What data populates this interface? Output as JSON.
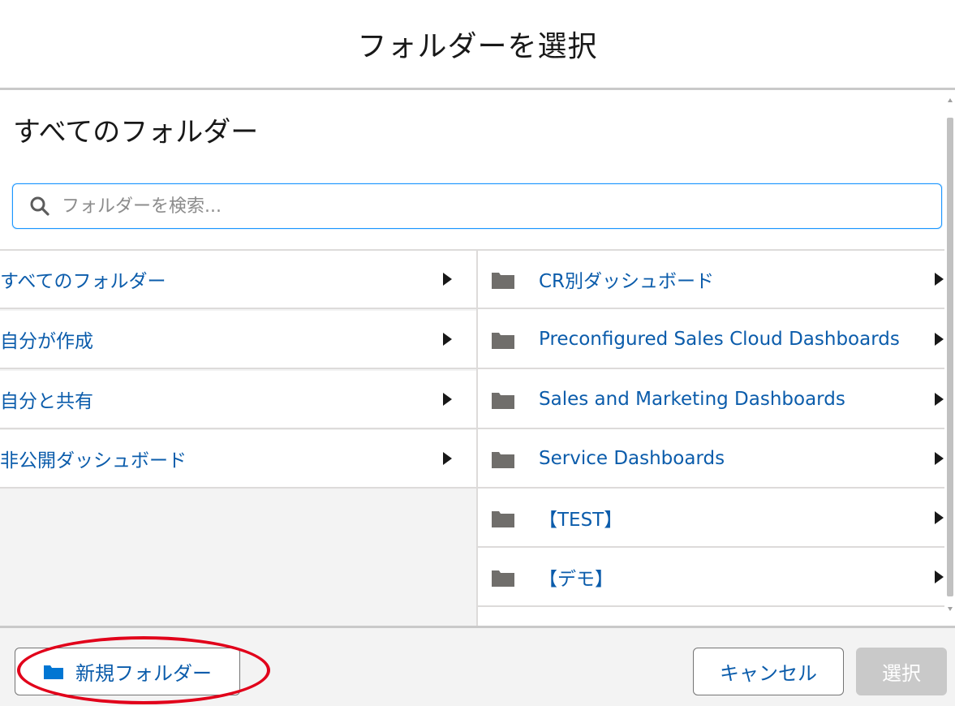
{
  "modal": {
    "title": "フォルダーを選択"
  },
  "section": {
    "heading": "すべてのフォルダー"
  },
  "search": {
    "placeholder": "フォルダーを検索...",
    "value": ""
  },
  "left_items": [
    {
      "label": "すべてのフォルダー"
    },
    {
      "label": "自分が作成"
    },
    {
      "label": "自分と共有"
    },
    {
      "label": "非公開ダッシュボード"
    }
  ],
  "right_items": [
    {
      "label": "CR別ダッシュボード"
    },
    {
      "label": "Preconfigured Sales Cloud Dashboards"
    },
    {
      "label": "Sales and Marketing Dashboards"
    },
    {
      "label": "Service Dashboards"
    },
    {
      "label": "【TEST】"
    },
    {
      "label": "【デモ】"
    }
  ],
  "footer": {
    "new_folder_label": "新規フォルダー",
    "cancel_label": "キャンセル",
    "select_label": "選択"
  },
  "colors": {
    "link": "#0b5cab",
    "focus_border": "#1b96ff",
    "highlight": "#e1001a",
    "disabled_button": "#c9c9c9"
  },
  "icons": {
    "search": "search-icon",
    "folder": "folder-icon",
    "arrow": "chevron-right-icon",
    "new_folder": "folder-icon"
  }
}
